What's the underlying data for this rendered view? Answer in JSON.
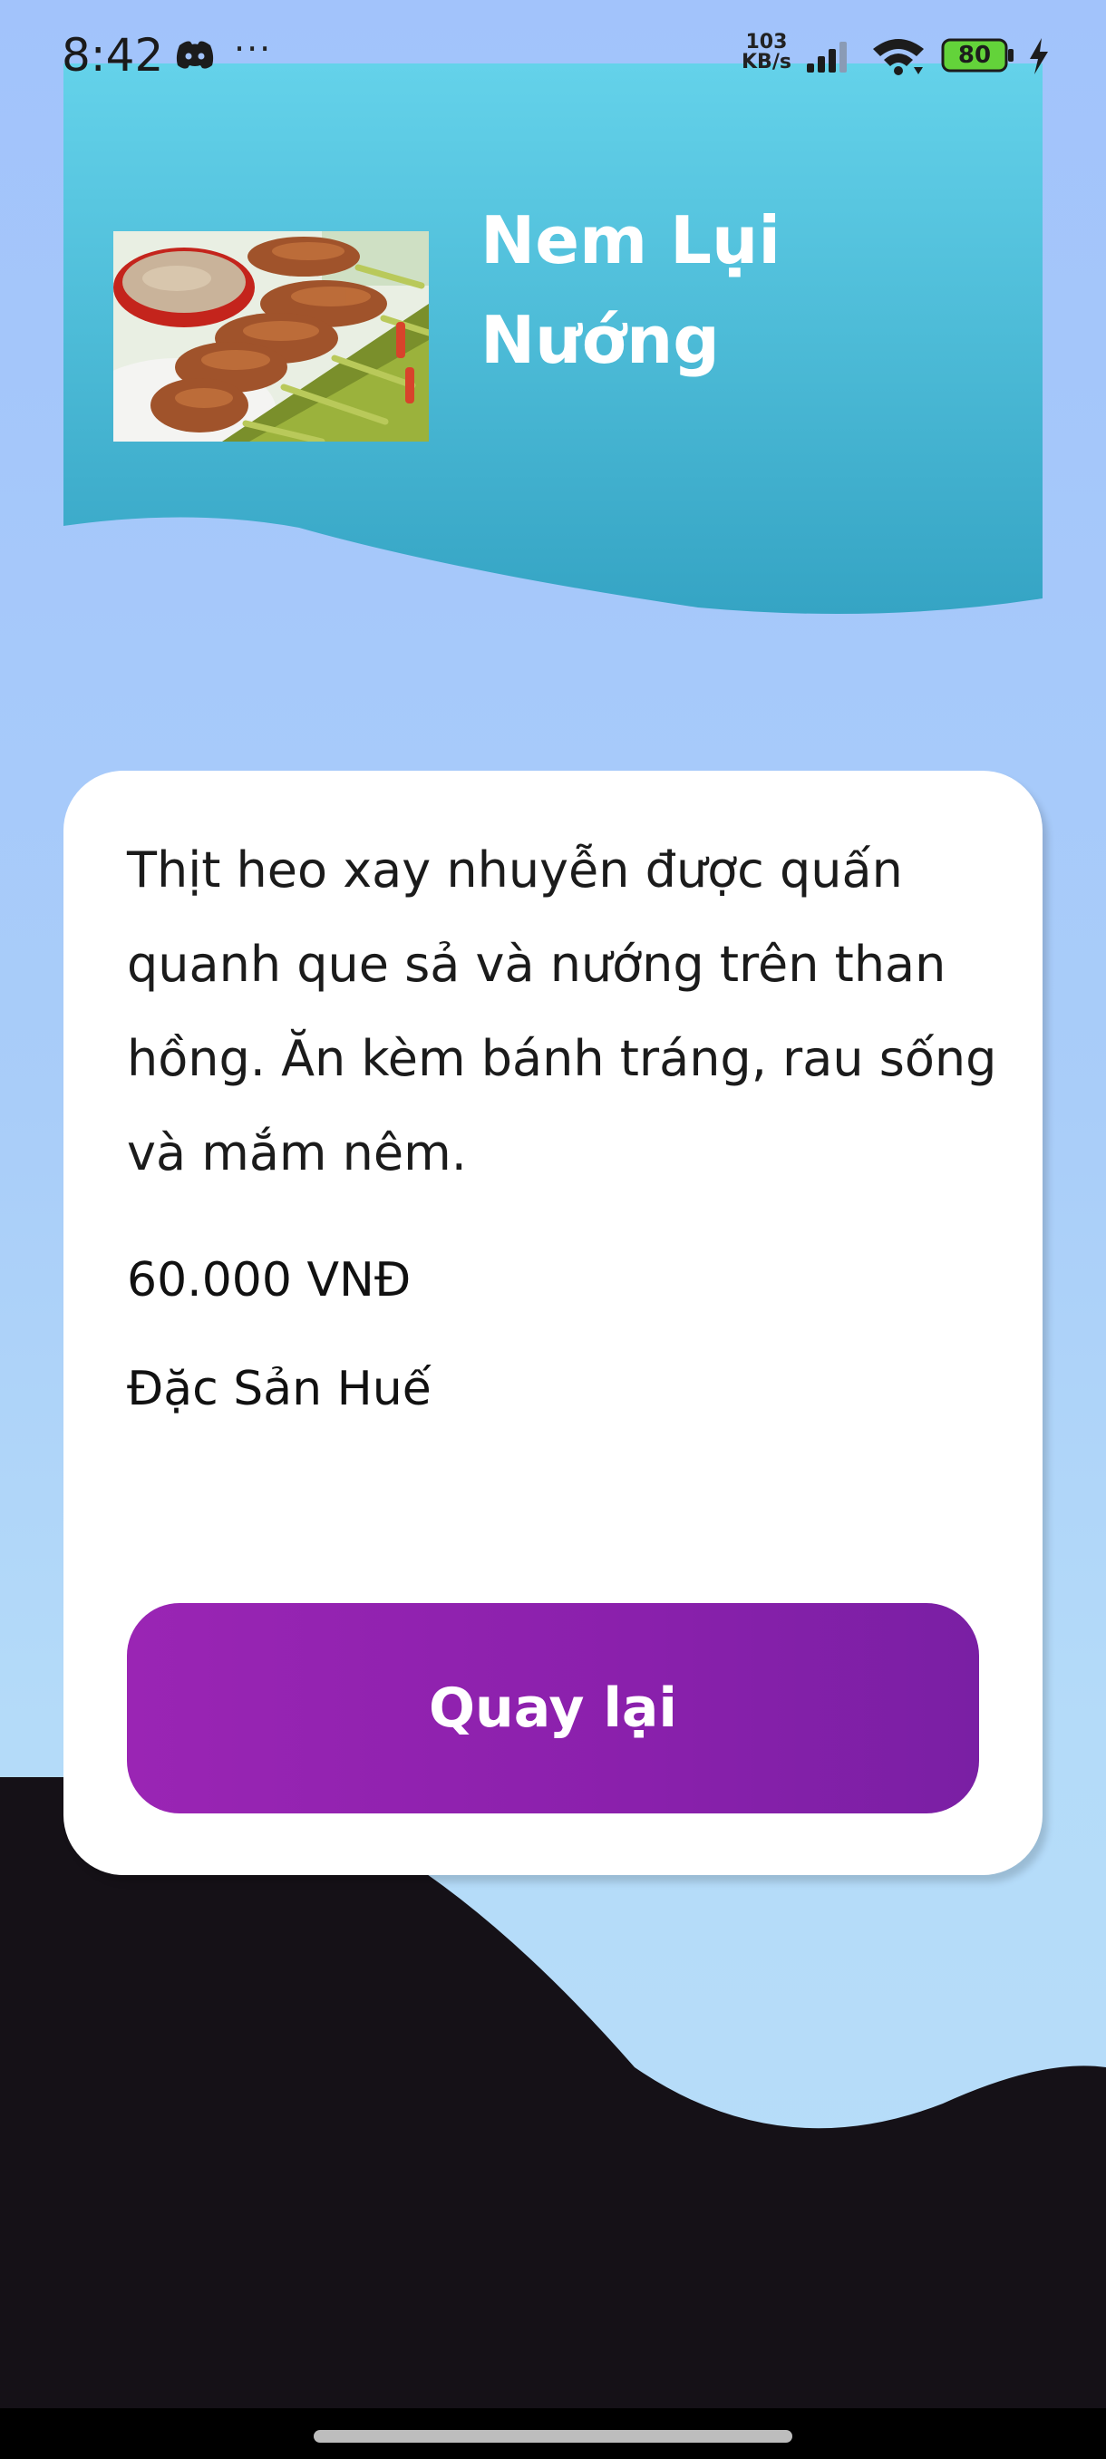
{
  "status_bar": {
    "time": "8:42",
    "more": "···",
    "net_speed_value": "103",
    "net_speed_unit": "KB/s",
    "battery": "80",
    "icons": [
      "discord-icon",
      "signal-icon",
      "wifi-icon",
      "battery-icon",
      "charging-icon"
    ]
  },
  "food": {
    "title": "Nem Lụi Nướng",
    "image": "nem-lui-photo",
    "description": "Thịt heo xay nhuyễn được quấn quanh que sả và nướng trên than hồng. Ăn kèm bánh tráng, rau sống và mắm nêm.",
    "price": "60.000 VNĐ",
    "category": "Đặc Sản Huế"
  },
  "actions": {
    "back_label": "Quay lại"
  },
  "colors": {
    "header_top": "#62d0e6",
    "header_bottom": "#39a9c6",
    "button_start": "#9a25b4",
    "button_end": "#7a1fa4",
    "background": "#a9cdf9",
    "bottom_wave": "#151117"
  }
}
